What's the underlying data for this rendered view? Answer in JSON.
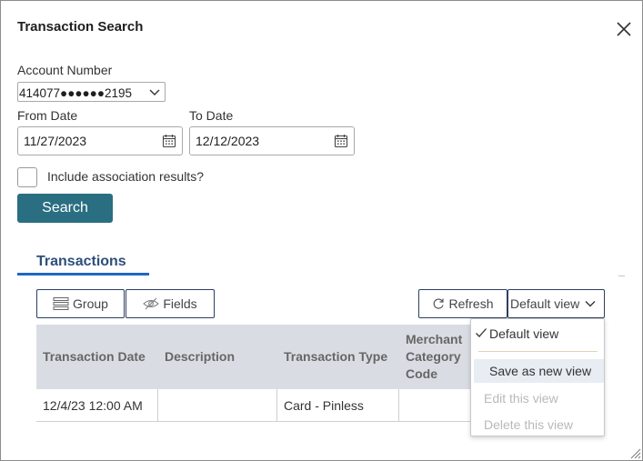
{
  "dialog": {
    "title": "Transaction Search"
  },
  "form": {
    "account_label": "Account Number",
    "account_value": "414077●●●●●●2195",
    "from_label": "From Date",
    "from_value": "11/27/2023",
    "to_label": "To Date",
    "to_value": "12/12/2023",
    "include_label": "Include association results?",
    "include_checked": false,
    "search_label": "Search"
  },
  "tabs": {
    "transactions": "Transactions"
  },
  "toolbar": {
    "group_label": "Group",
    "fields_label": "Fields",
    "refresh_label": "Refresh",
    "view_label": "Default view"
  },
  "table": {
    "columns": [
      "Transaction Date",
      "Description",
      "Transaction Type",
      "Merchant Category Code"
    ],
    "rows": [
      [
        "12/4/23 12:00 AM",
        "",
        "Card - Pinless",
        ""
      ]
    ]
  },
  "view_menu": {
    "items": [
      {
        "label": "Default view",
        "checked": true,
        "disabled": false
      },
      {
        "label": "Save as new view",
        "checked": false,
        "disabled": false
      },
      {
        "label": "Edit this view",
        "checked": false,
        "disabled": true
      },
      {
        "label": "Delete this view",
        "checked": false,
        "disabled": true
      }
    ]
  },
  "icons": {
    "close": "close-icon",
    "calendar": "calendar-icon",
    "chevron": "chevron-down-icon",
    "group": "group-icon",
    "fields": "eye-slash-icon",
    "refresh": "refresh-icon",
    "check": "checkmark-icon"
  },
  "colors": {
    "primary_button": "#2a6e82",
    "tab_underline": "#1f67c4",
    "table_header_bg": "#d9dde3",
    "toolbar_border": "#2d3e62"
  }
}
